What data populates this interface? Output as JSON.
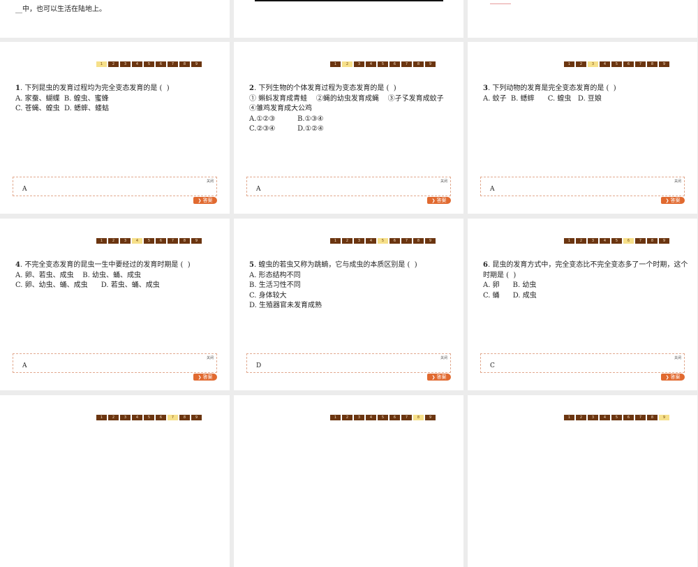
{
  "top_fragment": {
    "text": "__中，也可以生活在陆地上。"
  },
  "pages": [
    "1",
    "2",
    "3",
    "4",
    "5",
    "6",
    "7",
    "8",
    "9"
  ],
  "close_label": "关闭",
  "answer_button_label": "答案",
  "slides": [
    {
      "active_page": 1,
      "number": "1",
      "lines": [
        "下列昆虫的发育过程均为完全变态发育的是 (  )",
        "A. 家蚕、蝴蝶  B. 蝗虫、蜜蜂",
        "C. 苍蝇、蝗虫  D. 蟋蟀、蝼蛄"
      ],
      "answer": "A"
    },
    {
      "active_page": 2,
      "number": "2",
      "lines": [
        "下列生物的个体发育过程为变态发育的是 (  )",
        "① 蝌蚪发育成青蛙    ②蝇的幼虫发育成蝇    ③孑孓发育成蚊子",
        "④雏鸡发育成大公鸡",
        "A.①②③          B.①③④",
        "C.②③④          D.①②④"
      ],
      "answer": "A"
    },
    {
      "active_page": 3,
      "number": "3",
      "lines": [
        "下列动物的发育是完全变态发育的是 (  )",
        "A. 蚊子  B. 蟋蟀      C. 蝗虫   D. 豆娘"
      ],
      "answer": "A"
    },
    {
      "active_page": 4,
      "number": "4",
      "lines": [
        "不完全变态发育的昆虫一生中要经过的发育时期是 (  )",
        "A. 卵、若虫、成虫    B. 幼虫、蛹、成虫",
        "C. 卵、幼虫、蛹、成虫      D. 若虫、蛹、成虫"
      ],
      "answer": "A"
    },
    {
      "active_page": 5,
      "number": "5",
      "lines": [
        "蝗虫的若虫又称为跳蝻，它与成虫的本质区别是 (  )",
        "A. 形态结构不同",
        "B. 生活习性不同",
        "C. 身体较大",
        "D. 生殖器官未发育成熟"
      ],
      "answer": "D"
    },
    {
      "active_page": 6,
      "number": "6",
      "lines": [
        "昆虫的发育方式中，完全变态比不完全变态多了一个时期，这个",
        "时期是 (  )",
        "A. 卵      B. 幼虫",
        "C. 蛹      D. 成虫"
      ],
      "answer": "C"
    }
  ],
  "bottom_pagers": [
    7,
    8,
    9
  ]
}
